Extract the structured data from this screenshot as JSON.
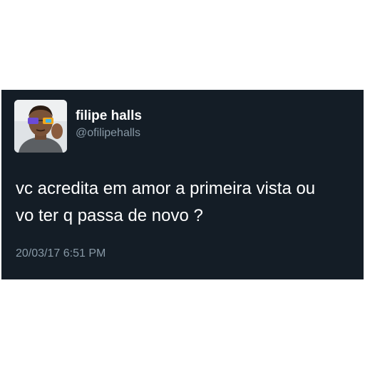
{
  "tweet": {
    "author": {
      "display_name": "filipe halls",
      "handle": "@ofilipehalls",
      "avatar_icon": "profile-photo"
    },
    "text_lines": [
      "vc acredita em amor a primeira vista ou",
      "vo ter q passa de novo ?"
    ],
    "timestamp": "20/03/17 6:51 PM"
  },
  "colors": {
    "card_background": "#141d26",
    "primary_text": "#ffffff",
    "secondary_text": "#8899a6"
  }
}
